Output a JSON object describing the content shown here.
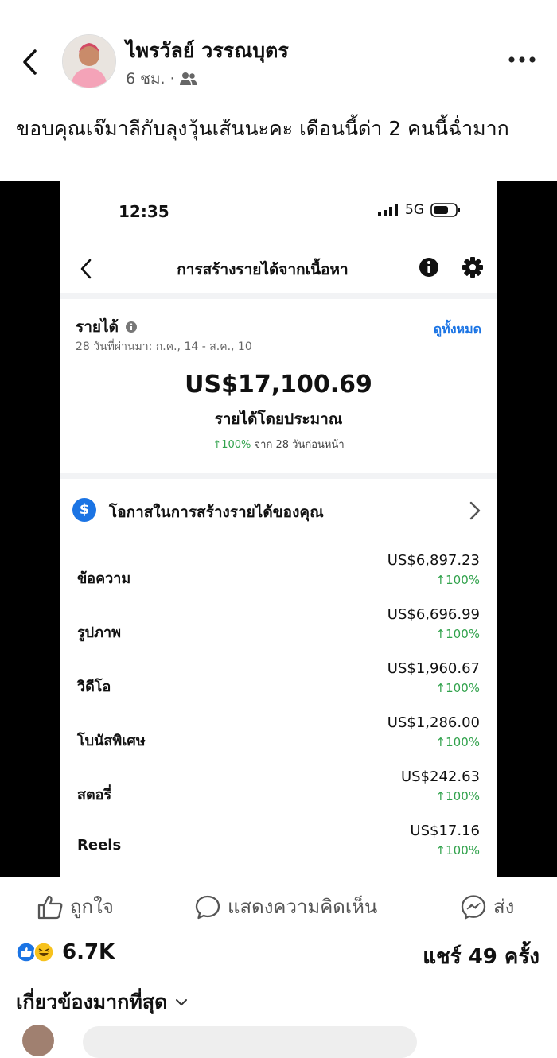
{
  "post": {
    "author": "ไพรวัลย์ วรรณบุตร",
    "time": "6 ชม.",
    "separator": "·",
    "text": "ขอบคุณเจ๊มาลีกับลุงวุ้นเส้นนะคะ เดือนนี้ด่า 2 คนนี้ฉ่ำมาก"
  },
  "screenshot": {
    "status": {
      "time": "12:35",
      "network": "5G"
    },
    "app_title": "การสร้างรายได้จากเนื้อหา",
    "earnings": {
      "heading": "รายได้",
      "range": "28 วันที่ผ่านมา: ก.ค., 14 - ส.ค., 10",
      "see_all": "ดูทั้งหมด",
      "total": "US$17,100.69",
      "total_label": "รายได้โดยประมาณ",
      "change_pct": "↑100%",
      "change_suffix": "จาก 28 วันก่อนหน้า"
    },
    "opportunities_label": "โอกาสในการสร้างรายได้ของคุณ",
    "income_rows": [
      {
        "label": "ข้อความ",
        "amount": "US$6,897.23",
        "change": "↑100%"
      },
      {
        "label": "รูปภาพ",
        "amount": "US$6,696.99",
        "change": "↑100%"
      },
      {
        "label": "วิดีโอ",
        "amount": "US$1,960.67",
        "change": "↑100%"
      },
      {
        "label": "โบนัสพิเศษ",
        "amount": "US$1,286.00",
        "change": "↑100%"
      },
      {
        "label": "สตอรี่",
        "amount": "US$242.63",
        "change": "↑100%"
      },
      {
        "label": "Reels",
        "amount": "US$17.16",
        "change": "↑100%"
      }
    ]
  },
  "actions": {
    "like": "ถูกใจ",
    "comment": "แสดงความคิดเห็น",
    "share": "ส่ง"
  },
  "stats": {
    "reactions": "6.7K",
    "shares": "แชร์ 49 ครั้ง"
  },
  "sort_label": "เกี่ยวข้องมากที่สุด",
  "colors": {
    "accent": "#1b74e4",
    "positive": "#31a24c"
  }
}
